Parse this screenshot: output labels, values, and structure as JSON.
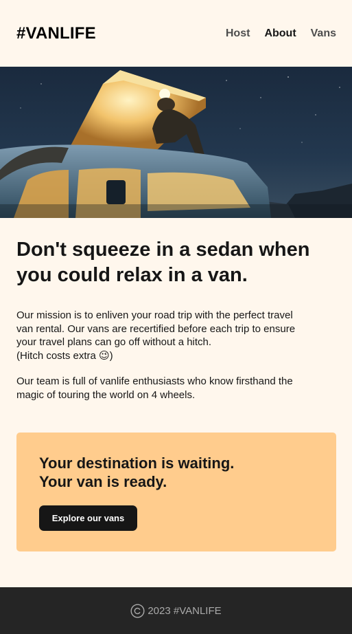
{
  "header": {
    "logo": "#VANLIFE",
    "nav": [
      {
        "label": "Host",
        "active": false
      },
      {
        "label": "About",
        "active": true
      },
      {
        "label": "Vans",
        "active": false
      }
    ]
  },
  "hero": {
    "image_icon": "van-camper-night-photo"
  },
  "main": {
    "headline": "Don't squeeze in a sedan when you could relax in a van.",
    "paragraph1": {
      "line1": "Our mission is to enliven your road trip with the perfect travel",
      "line2": "van rental. Our vans are recertified before each trip to ensure",
      "line3": "your travel plans can go off without a hitch.",
      "line4": "(Hitch costs extra 😉)"
    },
    "paragraph2": {
      "line1": "Our team is full of vanlife enthusiasts who know firsthand the",
      "line2": "magic of touring the world on 4 wheels."
    }
  },
  "cta": {
    "title_line1": "Your destination is waiting.",
    "title_line2": "Your van is ready.",
    "button_label": "Explore our vans"
  },
  "footer": {
    "text": "2023 #VANLIFE",
    "icon": "copyright-icon"
  },
  "colors": {
    "background": "#FFF7ED",
    "cta_background": "#FFCC8D",
    "dark": "#161616",
    "footer_background": "#252525",
    "footer_text": "#AAAAAA"
  }
}
